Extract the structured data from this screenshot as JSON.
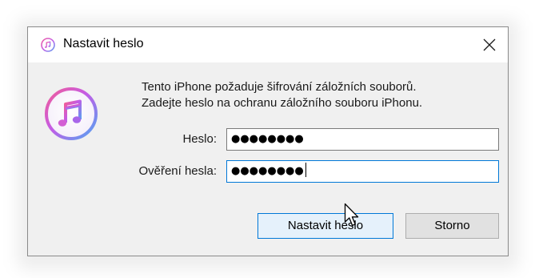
{
  "window": {
    "title": "Nastavit heslo",
    "icon": "itunes-icon",
    "close_icon": "close-icon"
  },
  "app_icon": "itunes-icon",
  "message": {
    "line1": "Tento iPhone požaduje šifrování záložních souborů.",
    "line2": "Zadejte heslo na ochranu záložního souboru iPhonu."
  },
  "fields": {
    "password": {
      "label": "Heslo:",
      "value": "●●●●●●●●"
    },
    "confirm": {
      "label": "Ověření hesla:",
      "value": "●●●●●●●●"
    }
  },
  "buttons": {
    "set_password": "Nastavit heslo",
    "cancel": "Storno"
  },
  "colors": {
    "accent": "#0078d7",
    "dialog_bg": "#f0f0f0",
    "primary_button_bg": "#e5f1fb"
  }
}
